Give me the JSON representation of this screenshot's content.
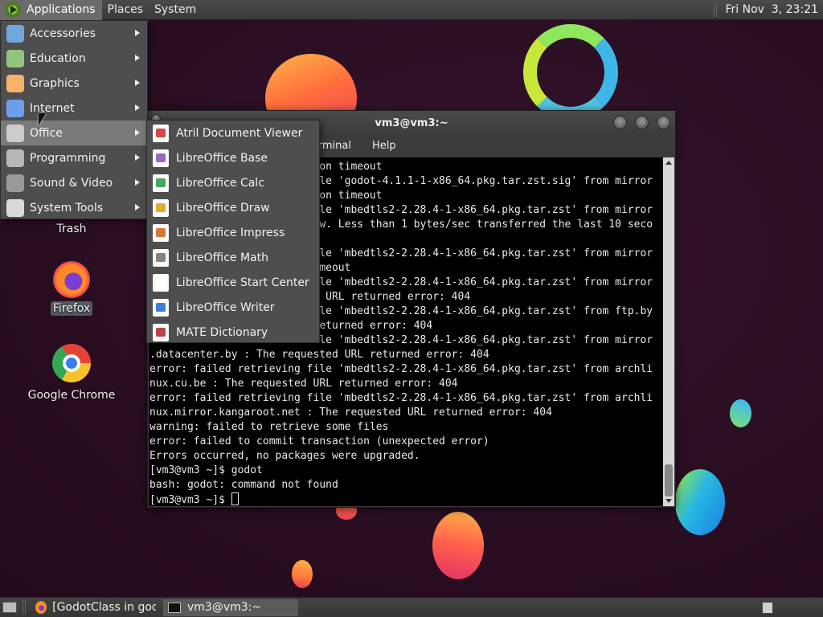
{
  "top_panel": {
    "applications": "Applications",
    "places": "Places",
    "system": "System",
    "clock": "Fri Nov  3, 23:21"
  },
  "apps_menu": {
    "items": [
      {
        "label": "Accessories",
        "icon": "accessories-icon",
        "color": "#6fa8dc"
      },
      {
        "label": "Education",
        "icon": "education-icon",
        "color": "#93c47d"
      },
      {
        "label": "Graphics",
        "icon": "graphics-icon",
        "color": "#f6b26b"
      },
      {
        "label": "Internet",
        "icon": "internet-icon",
        "color": "#6d9eeb"
      },
      {
        "label": "Office",
        "icon": "office-icon",
        "color": "#cccccc"
      },
      {
        "label": "Programming",
        "icon": "programming-icon",
        "color": "#b7b7b7"
      },
      {
        "label": "Sound & Video",
        "icon": "sound-video-icon",
        "color": "#999999"
      },
      {
        "label": "System Tools",
        "icon": "system-tools-icon",
        "color": "#d9d9d9"
      }
    ]
  },
  "office_menu": {
    "items": [
      {
        "label": "Atril Document Viewer",
        "icon": "atril-icon",
        "color": "#cc3333"
      },
      {
        "label": "LibreOffice Base",
        "icon": "libreoffice-base-icon",
        "color": "#8e5bb5"
      },
      {
        "label": "LibreOffice Calc",
        "icon": "libreoffice-calc-icon",
        "color": "#2e9e4a"
      },
      {
        "label": "LibreOffice Draw",
        "icon": "libreoffice-draw-icon",
        "color": "#e0a21a"
      },
      {
        "label": "LibreOffice Impress",
        "icon": "libreoffice-impress-icon",
        "color": "#d06a1c"
      },
      {
        "label": "LibreOffice Math",
        "icon": "libreoffice-math-icon",
        "color": "#777777"
      },
      {
        "label": "LibreOffice Start Center",
        "icon": "libreoffice-start-icon",
        "color": "#ffffff"
      },
      {
        "label": "LibreOffice Writer",
        "icon": "libreoffice-writer-icon",
        "color": "#2a6fcf"
      },
      {
        "label": "MATE Dictionary",
        "icon": "mate-dictionary-icon",
        "color": "#b03030"
      }
    ]
  },
  "desktop_icons": {
    "trash": "Trash",
    "firefox": "Firefox",
    "chrome": "Google Chrome"
  },
  "terminal": {
    "title": "vm3@vm3:~",
    "menu": {
      "terminal": "Terminal",
      "help": "Help"
    },
    "lines": [
      "                           on timeout",
      "                          ile 'godot-4.1.1-1-x86_64.pkg.tar.zst.sig' from mirror",
      "                           on timeout",
      "                          ile 'mbedtls2-2.28.4-1-x86_64.pkg.tar.zst' from mirror",
      "                          ow. Less than 1 bytes/sec transferred the last 10 seco",
      "",
      "                          ile 'mbedtls2-2.28.4-1-x86_64.pkg.tar.zst' from mirror",
      "                          imeout",
      "                          ile 'mbedtls2-2.28.4-1-x86_64.pkg.tar.zst' from mirror",
      "                          d URL returned error: 404",
      "                          ile 'mbedtls2-2.28.4-1-x86_64.pkg.tar.zst' from ftp.by",
      "                          returned error: 404",
      "                          ile 'mbedtls2-2.28.4-1-x86_64.pkg.tar.zst' from mirror",
      ".datacenter.by : The requested URL returned error: 404",
      "error: failed retrieving file 'mbedtls2-2.28.4-1-x86_64.pkg.tar.zst' from archli",
      "nux.cu.be : The requested URL returned error: 404",
      "error: failed retrieving file 'mbedtls2-2.28.4-1-x86_64.pkg.tar.zst' from archli",
      "nux.mirror.kangaroot.net : The requested URL returned error: 404",
      "warning: failed to retrieve some files",
      "error: failed to commit transaction (unexpected error)",
      "Errors occurred, no packages were upgraded.",
      "[vm3@vm3 ~]$ godot",
      "bash: godot: command not found"
    ],
    "prompt": "[vm3@vm3 ~]$ "
  },
  "taskbar": {
    "godot_task": "[GodotClass in god...",
    "terminal_task": "vm3@vm3:~"
  }
}
